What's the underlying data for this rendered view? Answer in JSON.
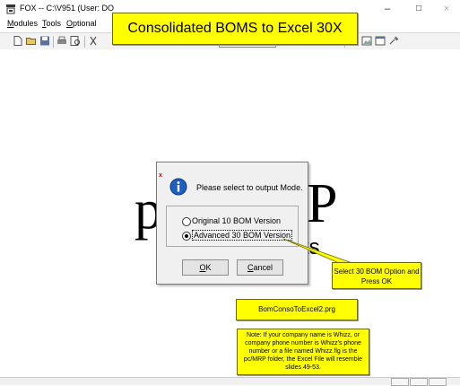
{
  "window": {
    "title": "FOX -- C:\\V951  (User: DO",
    "minimize_glyph": "–",
    "maximize_glyph": "□",
    "close_glyph": "×"
  },
  "menu": {
    "items": [
      {
        "key": "M",
        "rest": "odules"
      },
      {
        "key": "T",
        "rest": "ools"
      },
      {
        "key": "O",
        "rest": "ptional"
      }
    ]
  },
  "banner": {
    "text": "Consolidated BOMS to Excel 30X"
  },
  "background_logo": {
    "left": "p",
    "right": "P",
    "tail": "ts"
  },
  "dialog": {
    "close_glyph": "x",
    "prompt": "Please select to output Mode.",
    "options": [
      {
        "label": "Original 10 BOM Version",
        "selected": false
      },
      {
        "label": "Advanced 30 BOM Version",
        "selected": true
      }
    ],
    "ok": {
      "key": "O",
      "rest": "K"
    },
    "cancel": {
      "key": "C",
      "rest": "ancel"
    }
  },
  "callouts": {
    "option": "Select 30 BOM Option and Press OK",
    "file": "BomConsoToExcel2.prg",
    "note": "Note: If your company name is Whizz, or company phone number is Whizz's phone number or a file named Whizz.flg is the pc/MRP folder, the Excel File will resemble slides 49-53."
  },
  "colors": {
    "callout": "#ffff00",
    "dialog": "#f0f0f0"
  }
}
